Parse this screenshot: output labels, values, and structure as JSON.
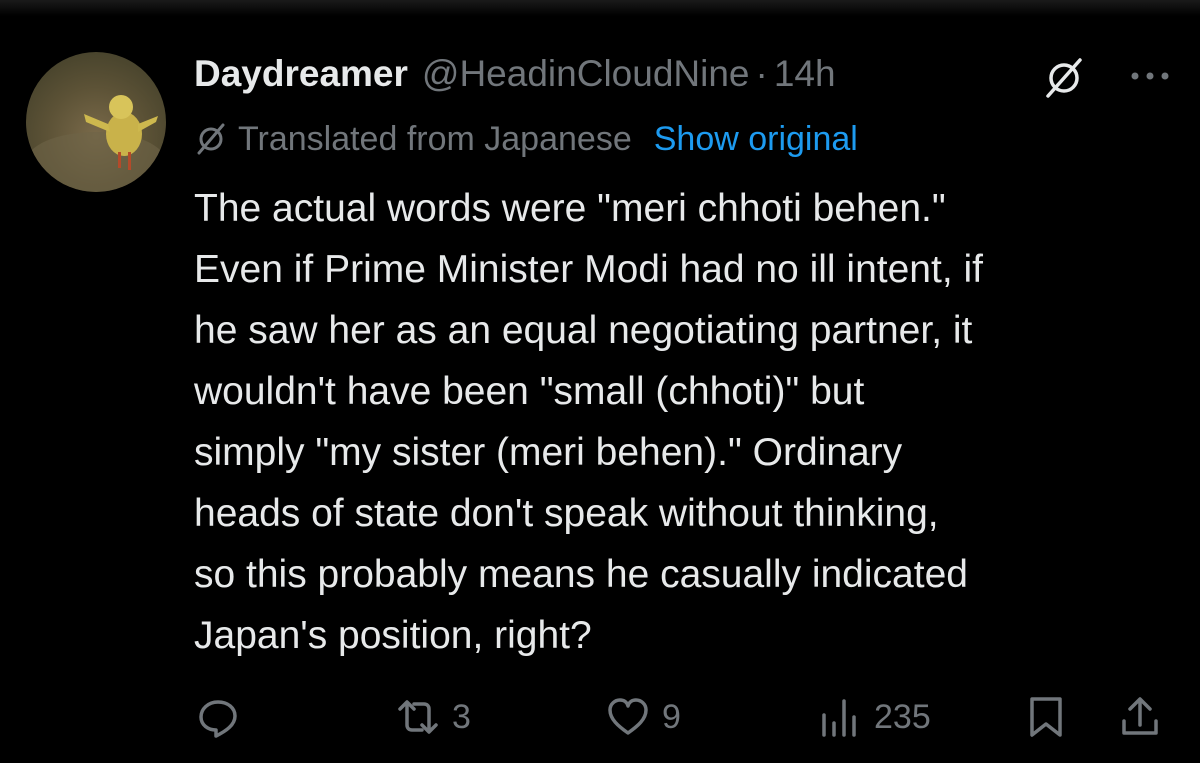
{
  "tweet": {
    "display_name": "Daydreamer",
    "handle": "@HeadinCloudNine",
    "separator": "·",
    "time": "14h",
    "translation_label": "Translated from Japanese",
    "show_original": "Show original",
    "text_lines": [
      "The actual words were \"meri chhoti behen.\"",
      "Even if Prime Minister Modi had no ill intent, if",
      "he saw her as an equal negotiating partner, it",
      "wouldn't have been \"small (chhoti)\" but",
      "simply \"my sister (meri behen).\" Ordinary",
      "heads of state don't speak without thinking,",
      "so this probably means he casually indicated",
      "Japan's position, right?"
    ]
  },
  "actions": {
    "reply": {
      "icon": "reply-icon",
      "count": ""
    },
    "retweet": {
      "icon": "retweet-icon",
      "count": "3"
    },
    "like": {
      "icon": "heart-icon",
      "count": "9"
    },
    "views": {
      "icon": "views-icon",
      "count": "235"
    },
    "bookmark": {
      "icon": "bookmark-icon"
    },
    "share": {
      "icon": "share-icon"
    }
  },
  "colors": {
    "background": "#000000",
    "text": "#e7e9ea",
    "secondary": "#71767b",
    "link": "#1d9bf0"
  }
}
